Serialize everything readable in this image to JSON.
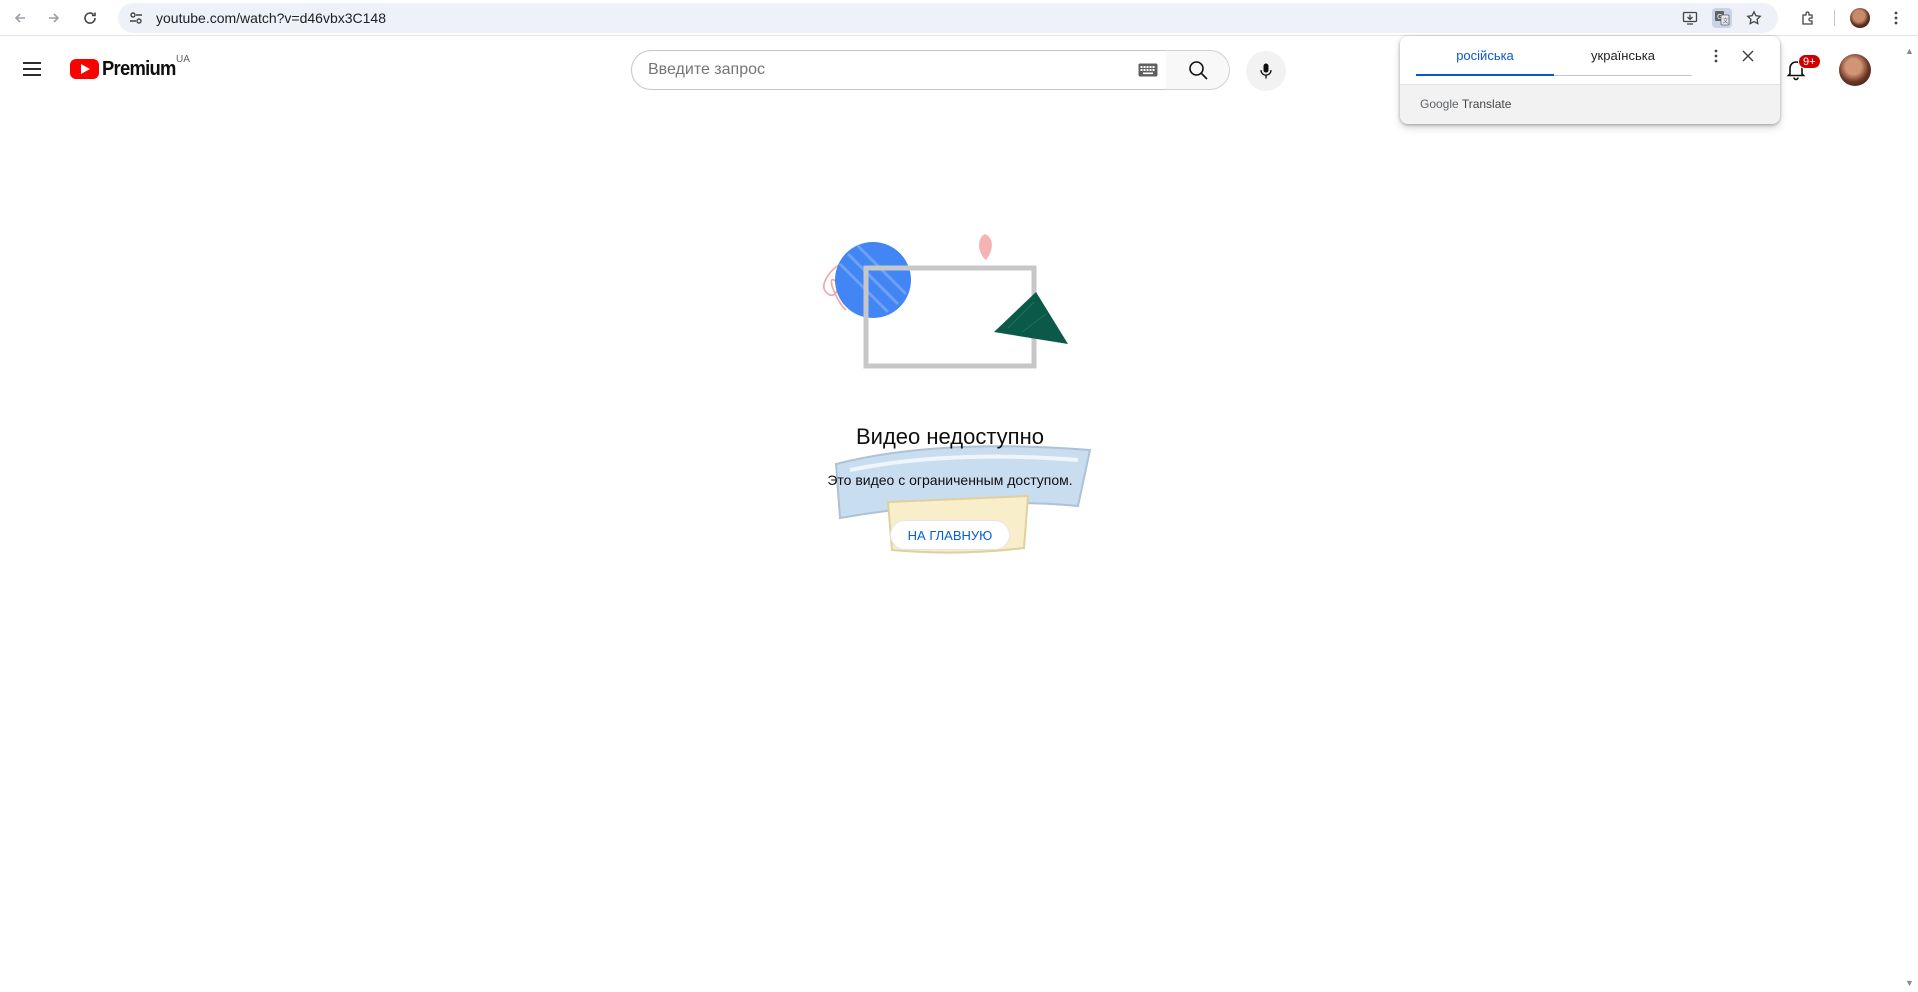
{
  "browser": {
    "url": "youtube.com/watch?v=d46vbx3C148"
  },
  "masthead": {
    "logo_text": "Premium",
    "country_code": "UA",
    "search_placeholder": "Введите запрос",
    "notifications_badge": "9+"
  },
  "translate_bubble": {
    "tabs": [
      {
        "label": "російська",
        "active": true
      },
      {
        "label": "українська",
        "active": false
      }
    ],
    "brand": "Google",
    "brand_suffix": "Translate"
  },
  "error": {
    "title": "Видео недоступно",
    "subtitle": "Это видео с ограниченным доступом.",
    "home_button": "НА ГЛАВНУЮ"
  },
  "colors": {
    "accent_blue": "#065fd4",
    "translate_blue": "#0b57d0",
    "youtube_red": "#ff0000",
    "badge_red": "#cc0000"
  }
}
